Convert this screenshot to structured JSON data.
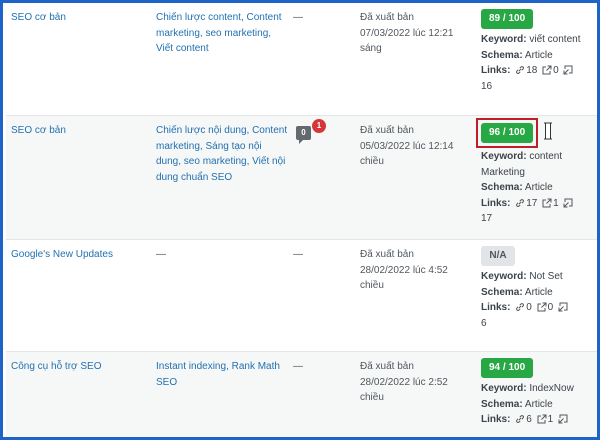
{
  "rows": [
    {
      "category": "SEO cơ bản",
      "tags": "Chiến lược content, Content marketing, seo marketing, Viết content",
      "comments": "—",
      "status": "Đã xuất bản",
      "date": "07/03/2022 lúc 12:21 sáng",
      "score": "89 / 100",
      "keyword_label": "Keyword:",
      "keyword": "viết content",
      "schema_label": "Schema:",
      "schema": "Article",
      "links_label": "Links:",
      "internal": "18",
      "external": "0",
      "incoming": "16"
    },
    {
      "category": "SEO cơ bản",
      "tags": "Chiến lược nội dung, Content marketing, Sáng tạo nội dung, seo marketing, Viết nội dung chuẩn SEO",
      "comment_count": "0",
      "comment_pending": "1",
      "status": "Đã xuất bản",
      "date": "05/03/2022 lúc 12:14 chiều",
      "score": "96 / 100",
      "keyword_label": "Keyword:",
      "keyword": "content Marketing",
      "schema_label": "Schema:",
      "schema": "Article",
      "links_label": "Links:",
      "internal": "17",
      "external": "1",
      "incoming": "17"
    },
    {
      "category": "Google's New Updates",
      "tags": "—",
      "comments": "—",
      "status": "Đã xuất bản",
      "date": "28/02/2022 lúc 4:52 chiều",
      "score": "N/A",
      "keyword_label": "Keyword:",
      "keyword": "Not Set",
      "schema_label": "Schema:",
      "schema": "Article",
      "links_label": "Links:",
      "internal": "0",
      "external": "0",
      "incoming": "6"
    },
    {
      "category": "Công cụ hỗ trợ SEO",
      "tags": "Instant indexing, Rank Math SEO",
      "comments": "—",
      "status": "Đã xuất bản",
      "date": "28/02/2022 lúc 2:52 chiều",
      "score": "94 / 100",
      "keyword_label": "Keyword:",
      "keyword": "IndexNow",
      "schema_label": "Schema:",
      "schema": "Article",
      "links_label": "Links:",
      "internal": "6",
      "external": "1",
      "incoming": ""
    }
  ],
  "colors": {
    "link": "#2271b1",
    "score_good": "#27a844",
    "score_na": "#e2e4e7",
    "highlight": "#c01e26",
    "frame": "#1e64c8"
  }
}
